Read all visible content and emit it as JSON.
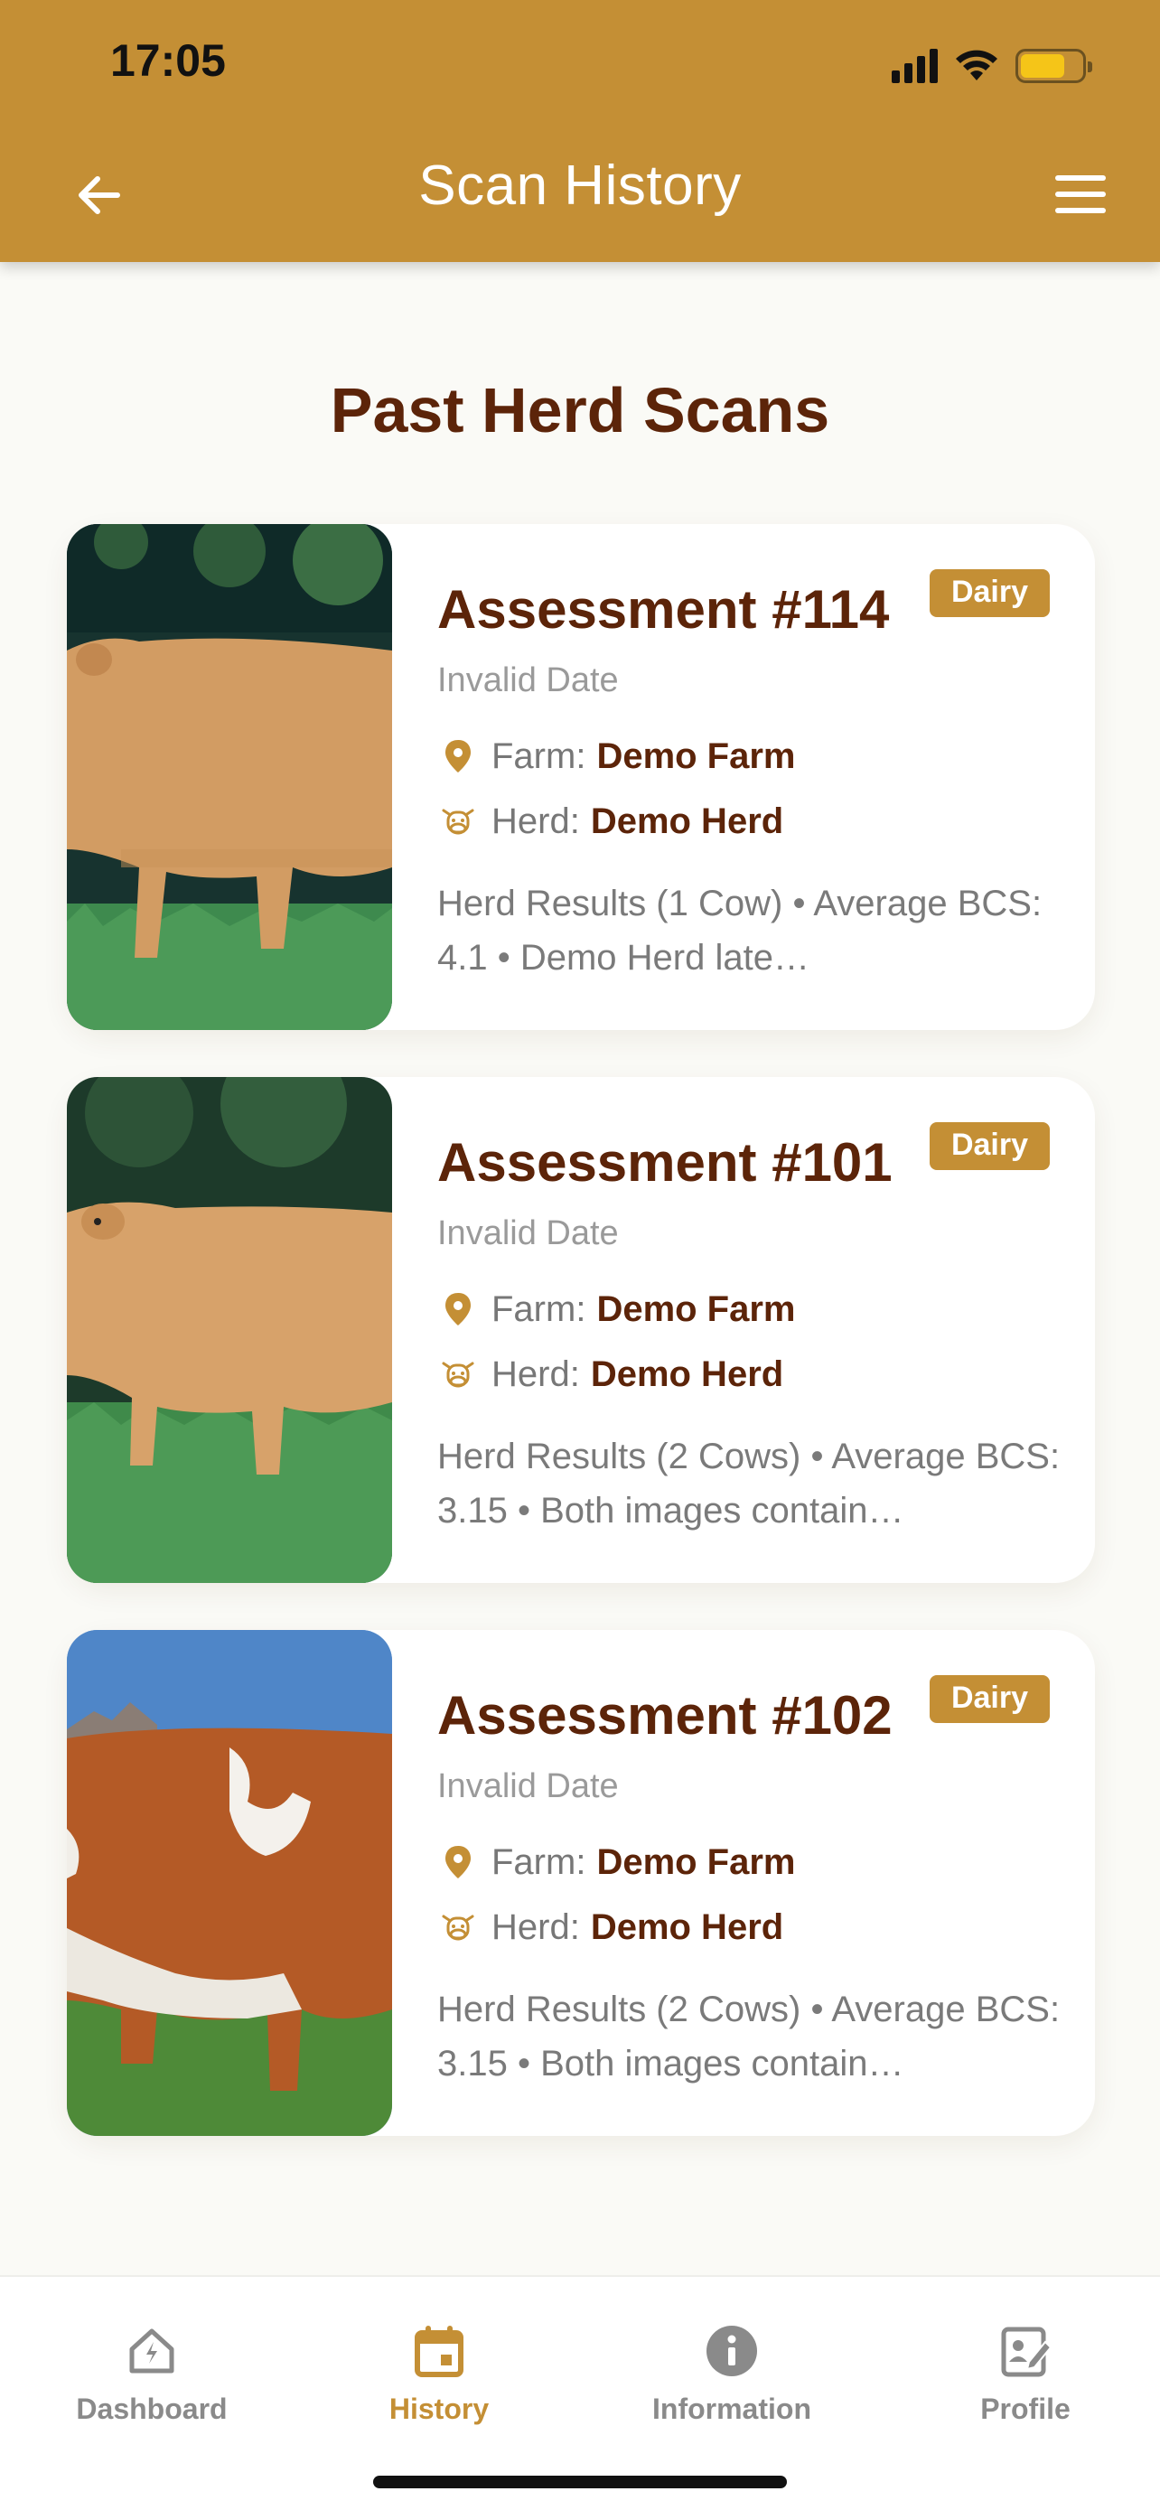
{
  "status_bar": {
    "time": "17:05"
  },
  "header": {
    "title": "Scan History",
    "back_icon": "arrow-left-icon",
    "menu_icon": "hamburger-menu-icon",
    "color": "#c48f35"
  },
  "section_title": "Past Herd Scans",
  "assessments": [
    {
      "title": "Assessment #114",
      "badge": "Dairy",
      "date": "Invalid Date",
      "farm_label": "Farm:",
      "farm": "Demo Farm",
      "herd_label": "Herd:",
      "herd": "Demo Herd",
      "summary": "Herd Results (1 Cow) • Average BCS: 4.1 • Demo Herd late…"
    },
    {
      "title": "Assessment #101",
      "badge": "Dairy",
      "date": "Invalid Date",
      "farm_label": "Farm:",
      "farm": "Demo Farm",
      "herd_label": "Herd:",
      "herd": "Demo Herd",
      "summary": "Herd Results (2 Cows) • Average BCS: 3.15 • Both images contain…"
    },
    {
      "title": "Assessment #102",
      "badge": "Dairy",
      "date": "Invalid Date",
      "farm_label": "Farm:",
      "farm": "Demo Farm",
      "herd_label": "Herd:",
      "herd": "Demo Herd",
      "summary": "Herd Results (2 Cows) • Average BCS: 3.15 • Both images contain…"
    }
  ],
  "bottom_nav": {
    "items": [
      {
        "label": "Dashboard",
        "icon": "home-icon",
        "active": false
      },
      {
        "label": "History",
        "icon": "calendar-icon",
        "active": true
      },
      {
        "label": "Information",
        "icon": "info-icon",
        "active": false
      },
      {
        "label": "Profile",
        "icon": "edit-profile-icon",
        "active": false
      }
    ]
  },
  "colors": {
    "accent": "#c48f35",
    "title_brown": "#5c2409",
    "background": "#fafaf6"
  }
}
